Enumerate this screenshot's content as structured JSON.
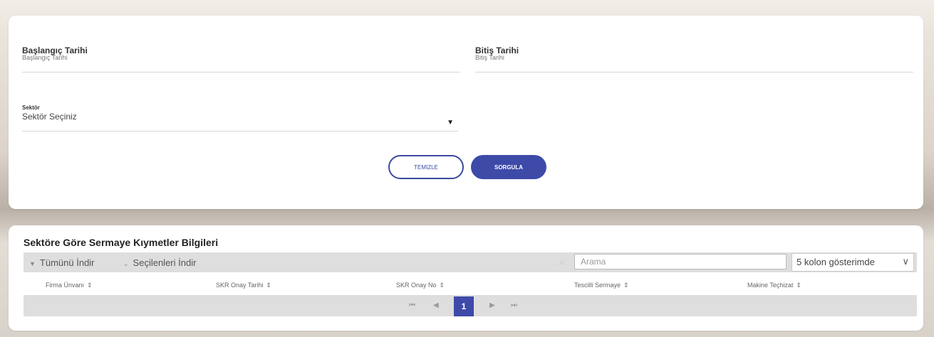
{
  "filters": {
    "start_date": {
      "label": "Başlangıç Tarihi",
      "sublabel": "Başlangıç Tarihi"
    },
    "end_date": {
      "label": "Bitiş Tarihi",
      "sublabel": "Bitiş Tarihi"
    },
    "sector": {
      "label": "Sektör",
      "value": "Sektör Seçiniz"
    },
    "clear_label": "TEMİZLE",
    "query_label": "SORGULA"
  },
  "table": {
    "title": "Sektöre Göre Sermaye Kıymetler Bilgileri",
    "download_all": "Tümünü İndir",
    "download_selected": "Seçilenleri İndir",
    "search_placeholder": "Arama",
    "columns_shown": "5 kolon gösterimde",
    "headers": [
      "Firma Ünvanı",
      "SKR Onay Tarihi",
      "SKR Onay No",
      "Tescilli Sermaye",
      "Makine Teçhizat"
    ],
    "current_page": "1"
  },
  "colors": {
    "accent": "#3e4aa8",
    "toolbar_bg": "#dedede"
  }
}
